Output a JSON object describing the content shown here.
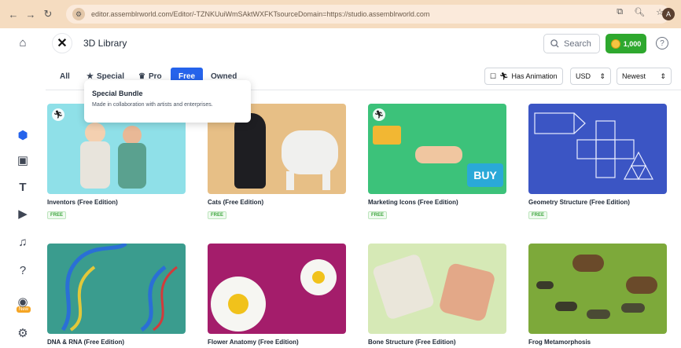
{
  "browser": {
    "url": "editor.assemblrworld.com/Editor/-TZNKUuiWmSAktWXFKTsourceDomain=https://studio.assemblrworld.com",
    "profile_initial": "A"
  },
  "header": {
    "title": "3D Library",
    "search_label": "Search",
    "coins": "1,000"
  },
  "filters": {
    "tabs": [
      {
        "label": "All"
      },
      {
        "label": "Special",
        "icon": "star-icon"
      },
      {
        "label": "Pro",
        "icon": "crown-icon"
      },
      {
        "label": "Free",
        "active": true
      },
      {
        "label": "Owned"
      }
    ],
    "has_animation": "Has Animation",
    "currency": "USD",
    "sort": "Newest"
  },
  "tooltip": {
    "title": "Special Bundle",
    "description": "Made in collaboration with artists and enterprises."
  },
  "sidebar": {
    "items": [
      "home-icon",
      "cube-icon",
      "image-icon",
      "text-icon",
      "video-icon",
      "music-icon",
      "help-icon",
      "camera-icon",
      "settings-icon"
    ],
    "new_badge": "New"
  },
  "cards": [
    {
      "title": "Inventors (Free Edition)",
      "badge": "FREE",
      "bg": "#8fe0e8",
      "animated": true
    },
    {
      "title": "Cats (Free Edition)",
      "badge": "FREE",
      "bg": "#e7bf86",
      "animated": false
    },
    {
      "title": "Marketing Icons (Free Edition)",
      "badge": "FREE",
      "bg": "#3cc27a",
      "animated": true
    },
    {
      "title": "Geometry Structure (Free Edition)",
      "badge": "FREE",
      "bg": "#3b55c4",
      "animated": false
    },
    {
      "title": "DNA & RNA (Free Edition)",
      "badge": "",
      "bg": "#3a9c8e",
      "animated": false
    },
    {
      "title": "Flower Anatomy (Free Edition)",
      "badge": "",
      "bg": "#a41d6b",
      "animated": false
    },
    {
      "title": "Bone Structure (Free Edition)",
      "badge": "",
      "bg": "#d6e9b6",
      "animated": false
    },
    {
      "title": "Frog Metamorphosis",
      "badge": "",
      "bg": "#7da93a",
      "animated": false
    }
  ]
}
